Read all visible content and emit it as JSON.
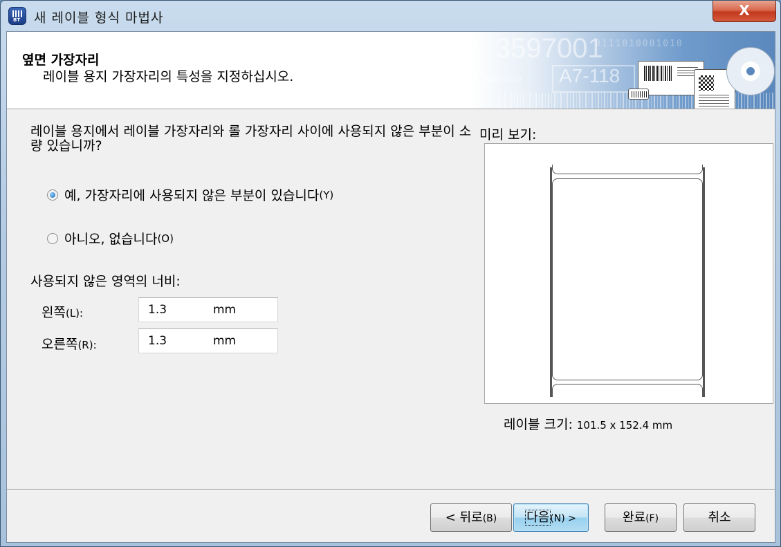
{
  "window": {
    "title": "새 레이블 형식 마법사",
    "close_glyph": "X"
  },
  "header": {
    "title": "옆면 가장자리",
    "subtitle": "레이블 용지 가장자리의 특성을 지정하십시오.",
    "banner": {
      "number_text": "3597001",
      "code_text": "A7-118",
      "date_text": "MAY2000",
      "bits_text": "0111010001010"
    }
  },
  "form": {
    "question": "레이블 용지에서 레이블 가장자리와 롤 가장자리 사이에 사용되지 않은 부분이 소량 있습니까?",
    "radio_yes": {
      "label": "예, 가장자리에 사용되지 않은 부분이 있습니다",
      "accel": "(Y)",
      "checked": true
    },
    "radio_no": {
      "label": "아니오, 없습니다",
      "accel": "(O)",
      "checked": false
    },
    "width_label": "사용되지 않은 영역의 너비:",
    "left": {
      "label": "왼쪽",
      "accel": "(L):",
      "value": "1.3",
      "unit": "mm"
    },
    "right": {
      "label": "오른쪽",
      "accel": "(R):",
      "value": "1.3",
      "unit": "mm"
    }
  },
  "preview": {
    "label": "미리 보기:",
    "size_label": "레이블 크기:",
    "size_value": "101.5 x 152.4 mm"
  },
  "buttons": {
    "back": {
      "label": "< 뒤로",
      "accel": "(B)"
    },
    "next": {
      "label": "다음",
      "accel": "(N) >"
    },
    "finish": {
      "label": "완료",
      "accel": "(F)"
    },
    "cancel": {
      "label": "취소"
    }
  }
}
